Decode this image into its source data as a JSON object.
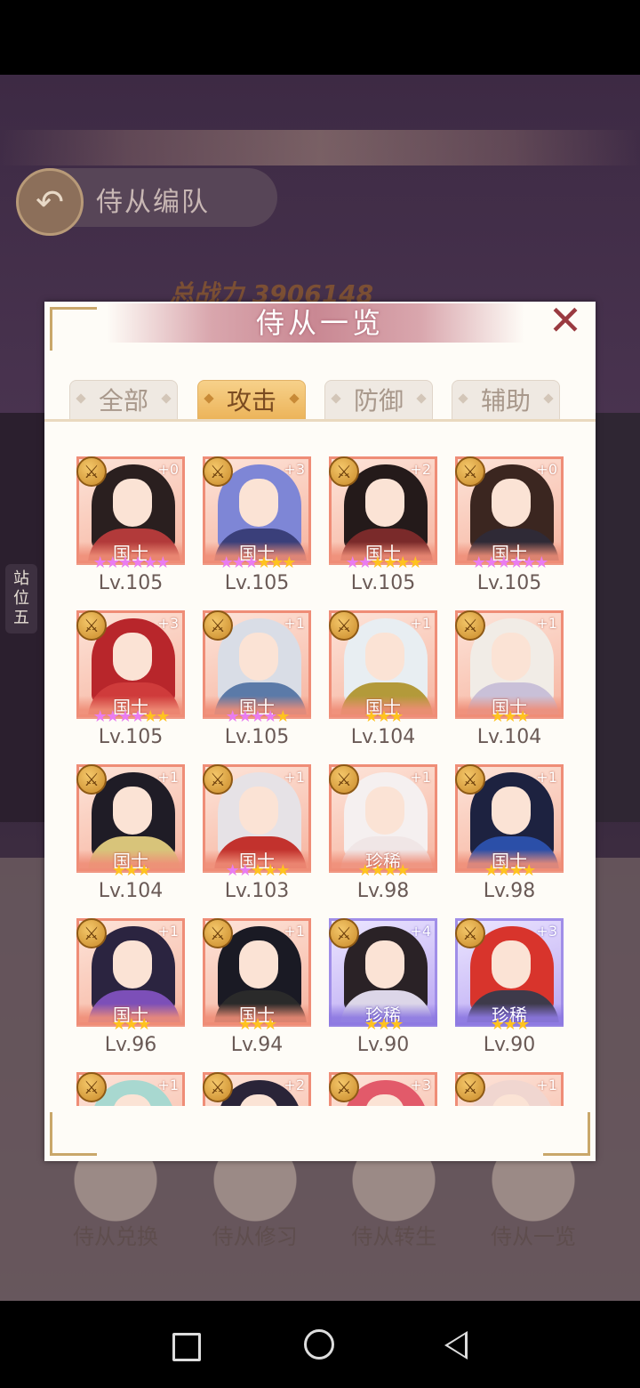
{
  "background": {
    "screen_title": "侍从编队",
    "power_label": "总战力",
    "power_value": "3906148",
    "side_position": "站位五",
    "bottom_buttons": [
      "侍从兑换",
      "侍从修习",
      "侍从转生",
      "侍从一览"
    ]
  },
  "dialog": {
    "title": "侍从一览",
    "close_icon": "close-x-icon",
    "tabs": [
      {
        "label": "全部",
        "active": false
      },
      {
        "label": "攻击",
        "active": true
      },
      {
        "label": "防御",
        "active": false
      },
      {
        "label": "辅助",
        "active": false
      }
    ]
  },
  "colors": {
    "tab_active": "#ecb45a",
    "rank_guoshi_frame": "#ef8d77",
    "rank_zhenxi_frame": "#a08ee8",
    "star_yellow": "#ffc21f",
    "star_purple": "#e97cf0"
  },
  "attendants": [
    {
      "plus": "+0",
      "rank": "国士",
      "level": "Lv.105",
      "stars_purple": 6,
      "stars_yellow": 0,
      "frame": "orange",
      "hair": "#2a1f1f",
      "robe": "#b23a3a"
    },
    {
      "plus": "+3",
      "rank": "国士",
      "level": "Lv.105",
      "stars_purple": 3,
      "stars_yellow": 3,
      "frame": "orange",
      "hair": "#7e86d6",
      "robe": "#3a3f7a"
    },
    {
      "plus": "+2",
      "rank": "国士",
      "level": "Lv.105",
      "stars_purple": 2,
      "stars_yellow": 4,
      "frame": "orange",
      "hair": "#241a1a",
      "robe": "#7a2a2a"
    },
    {
      "plus": "+0",
      "rank": "国士",
      "level": "Lv.105",
      "stars_purple": 6,
      "stars_yellow": 0,
      "frame": "orange",
      "hair": "#3b2620",
      "robe": "#2f2a36"
    },
    {
      "plus": "+3",
      "rank": "国士",
      "level": "Lv.105",
      "stars_purple": 4,
      "stars_yellow": 2,
      "frame": "orange",
      "hair": "#b8262b",
      "robe": "#cf3b3b"
    },
    {
      "plus": "+1",
      "rank": "国士",
      "level": "Lv.105",
      "stars_purple": 4,
      "stars_yellow": 1,
      "frame": "orange",
      "hair": "#d9dde6",
      "robe": "#5b7aa8"
    },
    {
      "plus": "+1",
      "rank": "国士",
      "level": "Lv.104",
      "stars_purple": 0,
      "stars_yellow": 3,
      "frame": "orange",
      "hair": "#e8eef2",
      "robe": "#b39a3a"
    },
    {
      "plus": "+1",
      "rank": "国士",
      "level": "Lv.104",
      "stars_purple": 0,
      "stars_yellow": 3,
      "frame": "orange",
      "hair": "#f1ece6",
      "robe": "#c9c0d8"
    },
    {
      "plus": "+1",
      "rank": "国士",
      "level": "Lv.104",
      "stars_purple": 0,
      "stars_yellow": 3,
      "frame": "orange",
      "hair": "#1f1c26",
      "robe": "#d8c47a"
    },
    {
      "plus": "+1",
      "rank": "国士",
      "level": "Lv.103",
      "stars_purple": 2,
      "stars_yellow": 3,
      "frame": "orange",
      "hair": "#e6e2e6",
      "robe": "#c2322d"
    },
    {
      "plus": "+1",
      "rank": "珍稀",
      "level": "Lv.98",
      "stars_purple": 0,
      "stars_yellow": 4,
      "frame": "orange",
      "hair": "#f5f0f0",
      "robe": "#f0e6e6"
    },
    {
      "plus": "+1",
      "rank": "国士",
      "level": "Lv.98",
      "stars_purple": 0,
      "stars_yellow": 4,
      "frame": "orange",
      "hair": "#1d2240",
      "robe": "#2b4fa8"
    },
    {
      "plus": "+1",
      "rank": "国士",
      "level": "Lv.96",
      "stars_purple": 0,
      "stars_yellow": 3,
      "frame": "orange",
      "hair": "#2b2440",
      "robe": "#7c4fb8"
    },
    {
      "plus": "+1",
      "rank": "国士",
      "level": "Lv.94",
      "stars_purple": 0,
      "stars_yellow": 3,
      "frame": "orange",
      "hair": "#1a1a24",
      "robe": "#2a2a2a"
    },
    {
      "plus": "+4",
      "rank": "珍稀",
      "level": "Lv.90",
      "stars_purple": 0,
      "stars_yellow": 3,
      "frame": "purple",
      "hair": "#2a2226",
      "robe": "#dcd6e8"
    },
    {
      "plus": "+3",
      "rank": "珍稀",
      "level": "Lv.90",
      "stars_purple": 0,
      "stars_yellow": 3,
      "frame": "purple",
      "hair": "#d8342c",
      "robe": "#3e3a4a"
    },
    {
      "plus": "+1",
      "rank": "",
      "level": "",
      "stars_purple": 0,
      "stars_yellow": 0,
      "frame": "orange",
      "hair": "#a8d8d0",
      "robe": "#cfe8e2"
    },
    {
      "plus": "+2",
      "rank": "",
      "level": "",
      "stars_purple": 0,
      "stars_yellow": 0,
      "frame": "orange",
      "hair": "#2a2438",
      "robe": "#6a5a80"
    },
    {
      "plus": "+3",
      "rank": "",
      "level": "",
      "stars_purple": 0,
      "stars_yellow": 0,
      "frame": "orange",
      "hair": "#e25a6a",
      "robe": "#f0b0b8"
    },
    {
      "plus": "+1",
      "rank": "",
      "level": "",
      "stars_purple": 0,
      "stars_yellow": 0,
      "frame": "orange",
      "hair": "#f0d6d0",
      "robe": "#e8d4d8"
    }
  ]
}
